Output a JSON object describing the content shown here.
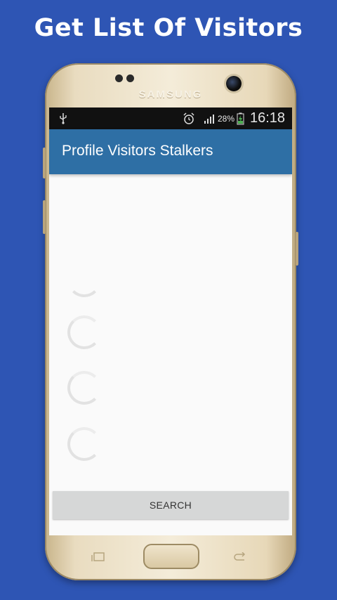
{
  "promo": {
    "headline": "Get List Of Visitors"
  },
  "device": {
    "brand": "SAMSUNG"
  },
  "statusbar": {
    "battery": "28%",
    "time": "16:18",
    "icons": [
      "usb-icon",
      "alarm-icon",
      "signal-icon",
      "battery-charging-icon"
    ]
  },
  "app": {
    "title": "Profile Visitors Stalkers",
    "search_label": "SEARCH",
    "loading_spinners": 4
  },
  "colors": {
    "background": "#2e55b4",
    "appbar": "#2e6fa5",
    "statusbar": "#111111",
    "button": "#d6d7d7"
  }
}
